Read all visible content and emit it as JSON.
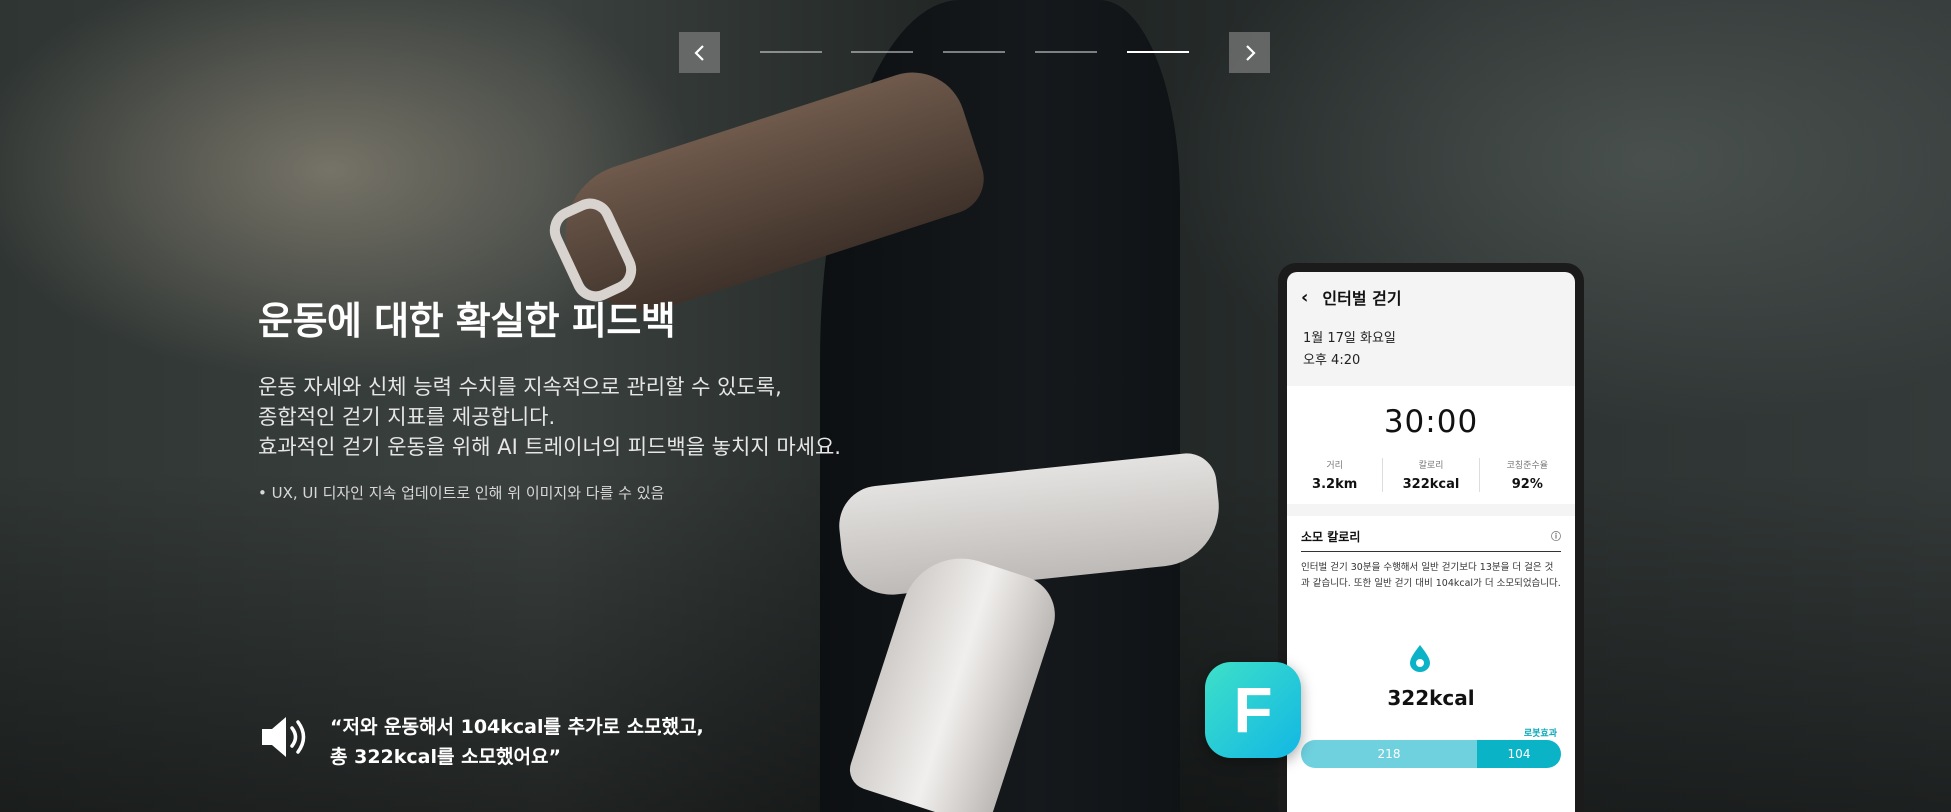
{
  "carousel": {
    "prev_icon": "chevron-left-icon",
    "next_icon": "chevron-right-icon",
    "slides_total": 5,
    "active_slide": 5
  },
  "hero": {
    "title": "운동에 대한 확실한 피드백",
    "description": [
      "운동 자세와 신체 능력 수치를 지속적으로 관리할 수 있도록,",
      "종합적인 걷기 지표를 제공합니다.",
      "효과적인 걷기 운동을 위해 AI 트레이너의 피드백을 놓치지 마세요."
    ],
    "note": "• UX, UI 디자인 지속 업데이트로 인해 위 이미지와 다를 수 있음",
    "speaker_icon": "speaker-icon",
    "quote_line1": "“저와 운동해서 104kcal를 추가로 소모했고,",
    "quote_line2": "총 322kcal를 소모했어요”"
  },
  "phone": {
    "header_title": "인터벌 걷기",
    "date": "1월 17일 화요일",
    "time_of_day": "오후 4:20",
    "duration": "30:00",
    "stats": [
      {
        "label": "거리",
        "value": "3.2km"
      },
      {
        "label": "칼로리",
        "value": "322kcal"
      },
      {
        "label": "코칭준수율",
        "value": "92%"
      }
    ],
    "calorie_section_title": "소모 칼로리",
    "calorie_desc": "인터벌 걷기 30분을 수행해서 일반 걷기보다 13분을 더 걸은 것과 같습니다. 또한 일반 걷기 대비 104kcal가 더 소모되었습니다.",
    "total_kcal": "322kcal",
    "robot_effect_label": "로봇효과",
    "bar_base": "218",
    "bar_robot": "104",
    "bar_base_fraction": 0.677
  },
  "app_icon": {
    "letter": "F"
  },
  "colors": {
    "accent": "#0bb3c7",
    "accent_light": "#6fd0de",
    "icon_grad_start": "#3ee0c8",
    "icon_grad_end": "#12b7e4"
  }
}
